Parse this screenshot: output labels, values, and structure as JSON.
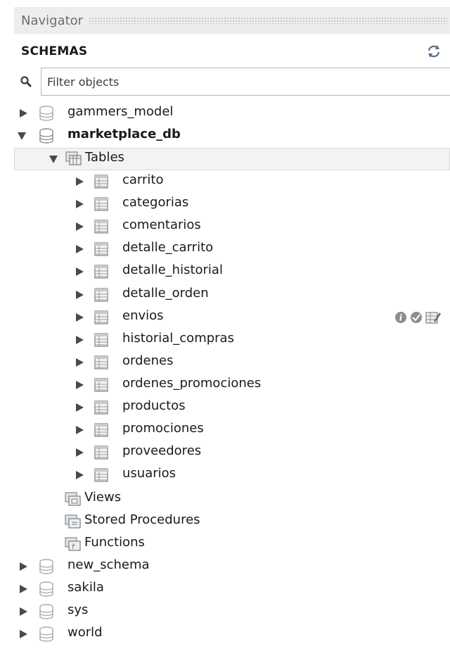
{
  "navigator": {
    "title": "Navigator",
    "schemas_label": "SCHEMAS",
    "filter_placeholder": "Filter objects"
  },
  "tree": {
    "schemas": [
      {
        "name": "gammers_model",
        "expanded": false
      },
      {
        "name": "marketplace_db",
        "expanded": true,
        "bold": true
      },
      {
        "name": "new_schema",
        "expanded": false
      },
      {
        "name": "sakila",
        "expanded": false
      },
      {
        "name": "sys",
        "expanded": false
      },
      {
        "name": "world",
        "expanded": false
      }
    ],
    "groups": {
      "tables": "Tables",
      "views": "Views",
      "procedures": "Stored Procedures",
      "functions": "Functions"
    },
    "tables": [
      "carrito",
      "categorias",
      "comentarios",
      "detalle_carrito",
      "detalle_historial",
      "detalle_orden",
      "envios",
      "historial_compras",
      "ordenes",
      "ordenes_promociones",
      "productos",
      "promociones",
      "proveedores",
      "usuarios"
    ],
    "hover_row": "envios",
    "hover_actions": [
      "info-icon",
      "inspect-icon",
      "edit-table-icon"
    ]
  },
  "colors": {
    "arrow": "#4a4a4a",
    "db_icon": "#a9a9a9",
    "table_icon": "#8a8a8a",
    "selection": "#f3f3f3",
    "header_bg": "#ededed"
  }
}
